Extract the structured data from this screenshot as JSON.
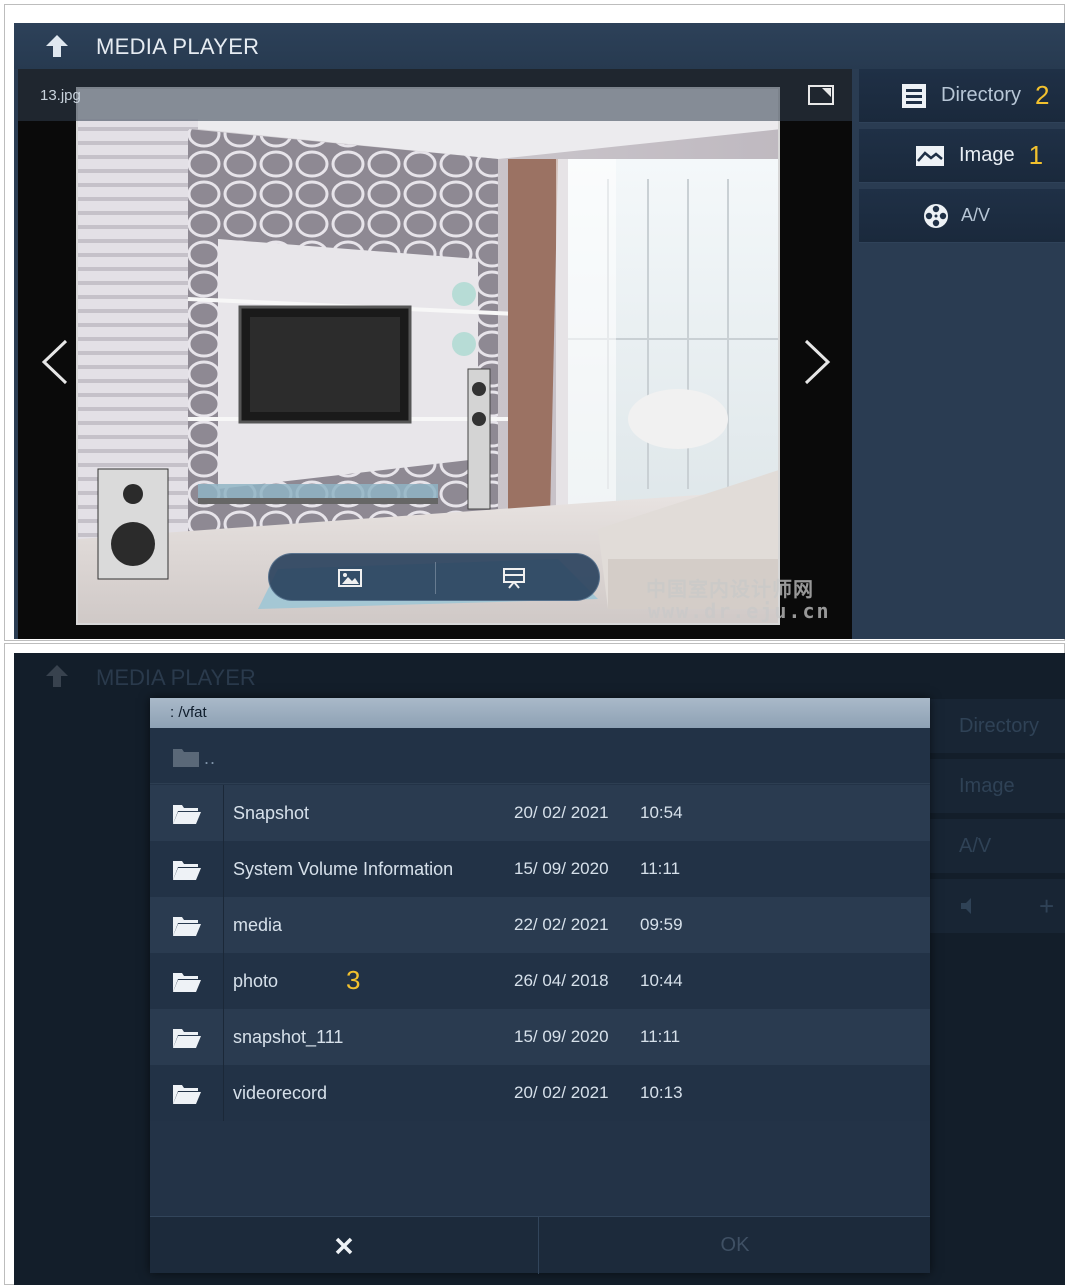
{
  "screen1": {
    "title": "MEDIA PLAYER",
    "filename": "13.jpg",
    "side_buttons": [
      {
        "label": "Directory",
        "marker": "2",
        "icon": "list-icon"
      },
      {
        "label": "Image",
        "marker": "1",
        "icon": "image-icon"
      },
      {
        "label": "A/V",
        "marker": "",
        "icon": "film-reel-icon"
      }
    ],
    "watermark": {
      "line1": "中国室内设计师网",
      "line2": "www.dr.eju.cn"
    }
  },
  "screen2": {
    "title": "MEDIA PLAYER",
    "background_side": [
      "Directory",
      "Image",
      "A/V"
    ],
    "dialog": {
      "path": ": /vfat",
      "parent_label": "..",
      "rows": [
        {
          "name": "Snapshot",
          "date": "20/ 02/ 2021",
          "time": "10:54",
          "marker": ""
        },
        {
          "name": "System Volume Information",
          "date": "15/ 09/ 2020",
          "time": "11:11",
          "marker": ""
        },
        {
          "name": "media",
          "date": "22/ 02/ 2021",
          "time": "09:59",
          "marker": ""
        },
        {
          "name": "photo",
          "date": "26/ 04/ 2018",
          "time": "10:44",
          "marker": "3"
        },
        {
          "name": "snapshot_111",
          "date": "15/ 09/ 2020",
          "time": "11:11",
          "marker": ""
        },
        {
          "name": "videorecord",
          "date": "20/ 02/ 2021",
          "time": "10:13",
          "marker": ""
        }
      ],
      "ok_label": "OK"
    }
  },
  "colors": {
    "accent_marker": "#f2c12e",
    "titlebar": "#2a3c52",
    "dialog_header": "#9fb0c2"
  }
}
